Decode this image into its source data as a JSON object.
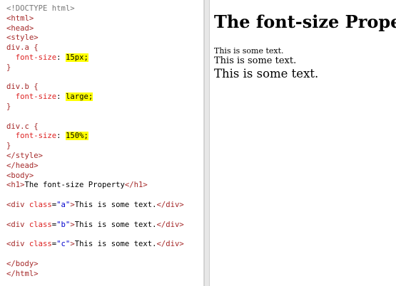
{
  "editor": {
    "lines": [
      {
        "type": "gray",
        "text": "<!DOCTYPE html>"
      },
      {
        "type": "tag",
        "text": "<html>"
      },
      {
        "type": "tag",
        "text": "<head>"
      },
      {
        "type": "tag",
        "text": "<style>"
      },
      {
        "type": "sel",
        "text": "div.a {"
      },
      {
        "type": "decl",
        "prop": "font-size",
        "value": "15px;"
      },
      {
        "type": "sel",
        "text": "}"
      },
      {
        "type": "blank",
        "text": ""
      },
      {
        "type": "sel",
        "text": "div.b {"
      },
      {
        "type": "decl",
        "prop": "font-size",
        "value": "large;"
      },
      {
        "type": "sel",
        "text": "}"
      },
      {
        "type": "blank",
        "text": ""
      },
      {
        "type": "sel",
        "text": "div.c {"
      },
      {
        "type": "decl",
        "prop": "font-size",
        "value": "150%;"
      },
      {
        "type": "sel",
        "text": "}"
      },
      {
        "type": "tag",
        "text": "</style>"
      },
      {
        "type": "tag",
        "text": "</head>"
      },
      {
        "type": "tag",
        "text": "<body>"
      },
      {
        "type": "h1",
        "open": "<h1>",
        "content": "The font-size Property",
        "close": "</h1>"
      },
      {
        "type": "blank",
        "text": ""
      },
      {
        "type": "div",
        "cls": "a",
        "content": "This is some text."
      },
      {
        "type": "blank",
        "text": ""
      },
      {
        "type": "div",
        "cls": "b",
        "content": "This is some text."
      },
      {
        "type": "blank",
        "text": ""
      },
      {
        "type": "div",
        "cls": "c",
        "content": "This is some text."
      },
      {
        "type": "blank",
        "text": ""
      },
      {
        "type": "tag",
        "text": "</body>"
      },
      {
        "type": "tag",
        "text": "</html>"
      }
    ]
  },
  "result": {
    "heading": "The font-size Property",
    "text_a": "This is some text.",
    "text_b": "This is some text.",
    "text_c": "This is some text."
  },
  "colors": {
    "highlight": "#ffff00",
    "tag": "#a52a2a",
    "property": "#dd2222",
    "string": "#0000cd"
  }
}
